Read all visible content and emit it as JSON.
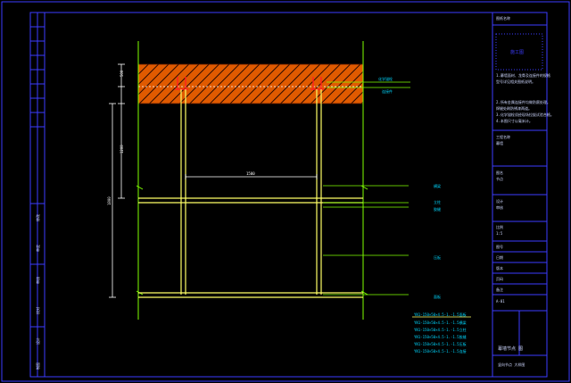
{
  "sheet": {
    "colors": {
      "background": "#000000",
      "frame": "#3c3cff",
      "wall": "#7fff00",
      "mullion": "#ffff66",
      "concrete_fill": "#e05a00",
      "dimension": "#ffffff",
      "callout": "#00d7ff",
      "anchor": "#ff2020"
    }
  },
  "title_block": {
    "header": "图纸名称",
    "stamp_label": "施工图",
    "note_lines": [
      "1.幕墙面材、龙骨及连接件的规格",
      "型号详见相关图纸说明。",
      "2.所有金属连接件均做防腐处理，",
      "焊缝处刷防锈漆两道。",
      "3.化学锚栓须经现场拉拔试验合格。",
      "4.本图尺寸以毫米计。"
    ],
    "fields": [
      {
        "label": "工程名称",
        "value": "幕墙"
      },
      {
        "label": "图名",
        "value": "节点"
      },
      {
        "label": "设计",
        "value": "审核"
      },
      {
        "label": "比例",
        "value": "1:5"
      }
    ],
    "stack": [
      "图号",
      "日期",
      "版本",
      "页码",
      "备注",
      "A-01"
    ],
    "drawing_no": "幕墙节点  图",
    "footer": "竖向节点 大样图"
  },
  "left_strip": {
    "labels": [
      "修改",
      "审定",
      "审核",
      "校对",
      "设计",
      "制图"
    ]
  },
  "callouts": {
    "top": [
      "化学锚栓",
      "连接件"
    ],
    "right": [
      "横梁",
      "立柱",
      "胶缝",
      "压板",
      "面板"
    ],
    "legend": [
      "YN1-150×50×4.5-1.-1.5面板",
      "YN1-150×50×4.5-1.-1.5横梁",
      "YN1-150×50×4.5-1.-1.5立柱",
      "YN1-150×50×4.5-1.-1.5胶缝",
      "YN1-150×50×4.5-1.-1.5压板",
      "YN1-150×50×4.5-1.-1.5连接"
    ]
  },
  "dimensions": {
    "vertical": [
      "500",
      "1200",
      "1800"
    ],
    "horizontal": "1500"
  }
}
